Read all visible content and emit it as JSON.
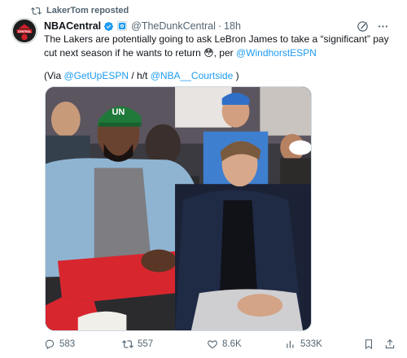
{
  "repost": {
    "label": "LakerTom reposted",
    "icon": "repost-icon"
  },
  "author": {
    "display_name": "NBACentral",
    "handle": "@TheDunkCentral",
    "time": "18h",
    "separator": "·",
    "avatar_text": "CENTRAL",
    "verified_color": "#1d9bf0"
  },
  "tweet": {
    "text_before": "The Lakers are potentially going to ask LeBron James to take a “significant” pay cut next season if he wants to return 😳, per ",
    "mention_windhorst": "@WindhorstESPN",
    "via_prefix": "(Via ",
    "mention_getup": "@GetUpESPN",
    "ht_text": " / h/t ",
    "mention_courtside": "@NBA__Courtside",
    "via_suffix": " )"
  },
  "media": {
    "cap_text": "UN"
  },
  "actions": {
    "replies": "583",
    "reposts": "557",
    "likes": "8.6K",
    "views": "533K"
  },
  "colors": {
    "link": "#1d9bf0",
    "muted": "#536471",
    "text": "#0f1419"
  }
}
